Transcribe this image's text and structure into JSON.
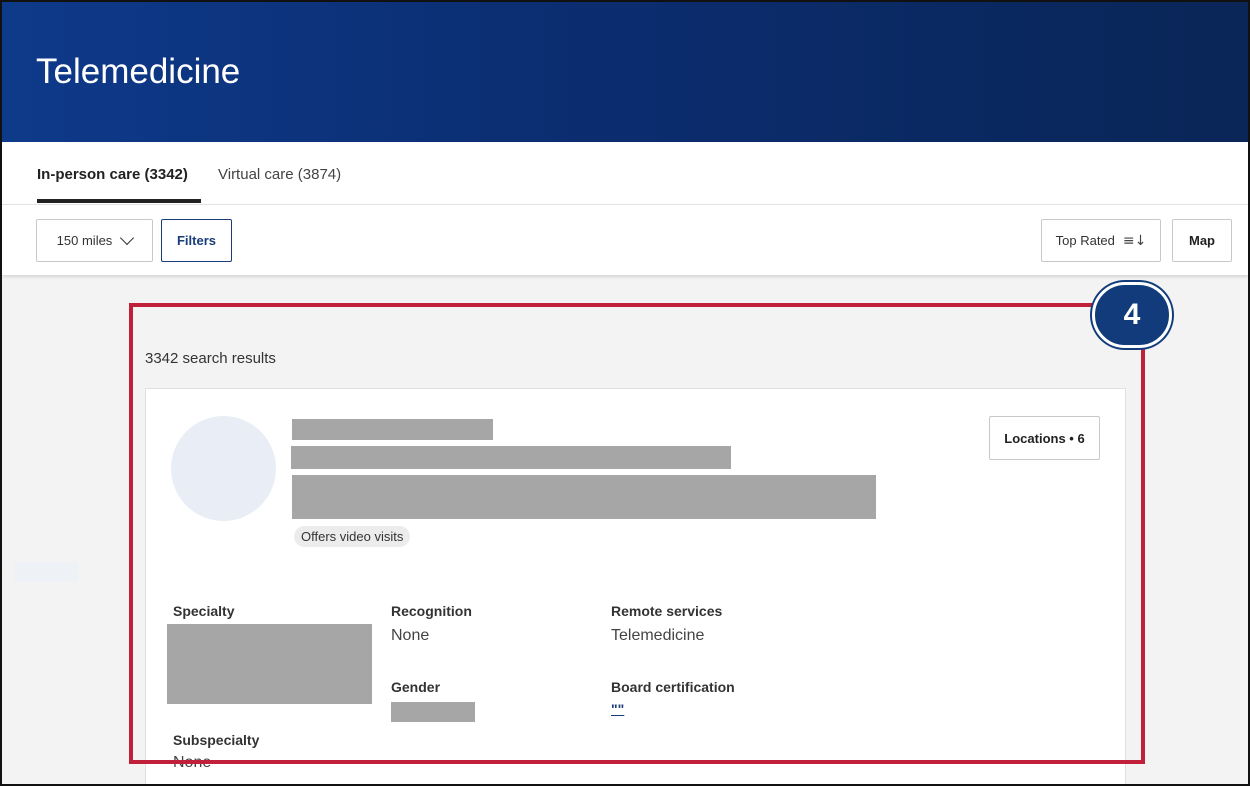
{
  "header": {
    "title": "Telemedicine"
  },
  "tabs": [
    {
      "label": "In-person care (3342)"
    },
    {
      "label": "Virtual care (3874)"
    }
  ],
  "toolbar": {
    "distance": "150 miles",
    "filters_label": "Filters",
    "sort_label": "Top Rated",
    "sort_icon": "≡↓",
    "map_label": "Map"
  },
  "results": {
    "count_text": "3342 search results"
  },
  "card": {
    "video_badge": "Offers video visits",
    "locations_label": "Locations • 6",
    "specialty_label": "Specialty",
    "recognition_label": "Recognition",
    "recognition_value": "None",
    "remote_label": "Remote services",
    "remote_value": "Telemedicine",
    "gender_label": "Gender",
    "board_label": "Board certification",
    "board_value": "\"\"",
    "subspecialty_label": "Subspecialty",
    "subspecialty_value": "None"
  },
  "callout": {
    "number": "4"
  },
  "colors": {
    "header": "#0e3a8a",
    "accent": "#1a3c7a",
    "highlight": "#c0203a"
  }
}
